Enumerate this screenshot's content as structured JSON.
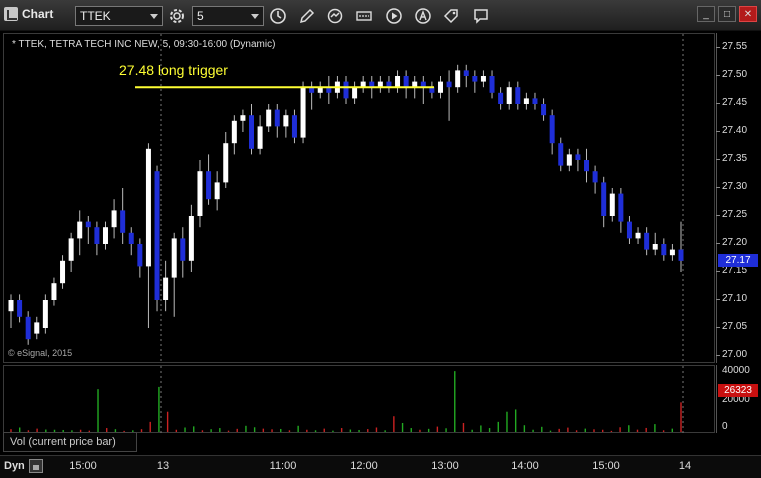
{
  "app": {
    "title": "Chart"
  },
  "toolbar": {
    "symbol": "TTEK",
    "interval": "5",
    "icons": [
      "gear-icon",
      "clock-icon",
      "pencil-icon",
      "refresh-icon",
      "quote-icon",
      "play-icon",
      "alert-icon",
      "tag-icon",
      "chat-icon"
    ]
  },
  "chart": {
    "info": "* TTEK, TETRA TECH INC NEW, 5, 09:30-16:00 (Dynamic)",
    "annotation": "27.48 long trigger",
    "copyright": "© eSignal, 2015",
    "last_price": "27.17",
    "price_ticks": [
      "27.55",
      "27.50",
      "27.45",
      "27.40",
      "27.35",
      "27.30",
      "27.25",
      "27.20",
      "27.15",
      "27.10",
      "27.05",
      "27.00"
    ],
    "volume_label": "Vol (current price bar)",
    "volume_ticks": [
      "40000",
      "20000",
      "0"
    ],
    "last_volume": "26323",
    "time_ticks": [
      "15:00",
      "13",
      "11:00",
      "12:00",
      "13:00",
      "14:00",
      "15:00",
      "14"
    ],
    "dyn_label": "Dyn",
    "colors": {
      "up": "#ffffff",
      "down": "#1f2ed8",
      "trigger": "#ffff33",
      "vol_up": "#22aa22",
      "vol_down": "#cc2222",
      "session_line": "#777777"
    }
  },
  "chart_data": {
    "type": "candlestick",
    "trigger_price": 27.48,
    "ylim": [
      27.0,
      27.56
    ],
    "candles": [
      [
        27.08,
        27.1,
        27.05,
        27.11,
        "u"
      ],
      [
        27.1,
        27.07,
        27.06,
        27.11,
        "d"
      ],
      [
        27.07,
        27.03,
        27.02,
        27.08,
        "d"
      ],
      [
        27.04,
        27.06,
        27.03,
        27.07,
        "u"
      ],
      [
        27.05,
        27.1,
        27.04,
        27.11,
        "u"
      ],
      [
        27.1,
        27.13,
        27.09,
        27.14,
        "u"
      ],
      [
        27.13,
        27.17,
        27.12,
        27.18,
        "u"
      ],
      [
        27.17,
        27.21,
        27.15,
        27.22,
        "u"
      ],
      [
        27.21,
        27.24,
        27.18,
        27.26,
        "u"
      ],
      [
        27.24,
        27.23,
        27.2,
        27.25,
        "d"
      ],
      [
        27.23,
        27.2,
        27.18,
        27.24,
        "d"
      ],
      [
        27.2,
        27.23,
        27.19,
        27.24,
        "u"
      ],
      [
        27.23,
        27.26,
        27.21,
        27.28,
        "u"
      ],
      [
        27.26,
        27.22,
        27.2,
        27.3,
        "d"
      ],
      [
        27.22,
        27.2,
        27.18,
        27.23,
        "d"
      ],
      [
        27.2,
        27.16,
        27.14,
        27.21,
        "d"
      ],
      [
        27.16,
        27.37,
        27.05,
        27.38,
        "u"
      ],
      [
        27.33,
        27.1,
        27.08,
        27.34,
        "d"
      ],
      [
        27.1,
        27.14,
        27.08,
        27.17,
        "u"
      ],
      [
        27.14,
        27.21,
        27.07,
        27.22,
        "u"
      ],
      [
        27.21,
        27.17,
        27.14,
        27.23,
        "d"
      ],
      [
        27.17,
        27.25,
        27.15,
        27.27,
        "u"
      ],
      [
        27.25,
        27.33,
        27.23,
        27.35,
        "u"
      ],
      [
        27.33,
        27.28,
        27.27,
        27.36,
        "d"
      ],
      [
        27.28,
        27.31,
        27.26,
        27.33,
        "u"
      ],
      [
        27.31,
        27.38,
        27.3,
        27.4,
        "u"
      ],
      [
        27.38,
        27.42,
        27.36,
        27.43,
        "u"
      ],
      [
        27.42,
        27.43,
        27.4,
        27.44,
        "u"
      ],
      [
        27.43,
        27.37,
        27.36,
        27.45,
        "d"
      ],
      [
        27.37,
        27.41,
        27.36,
        27.43,
        "u"
      ],
      [
        27.41,
        27.44,
        27.4,
        27.45,
        "u"
      ],
      [
        27.44,
        27.41,
        27.39,
        27.45,
        "d"
      ],
      [
        27.41,
        27.43,
        27.39,
        27.44,
        "u"
      ],
      [
        27.43,
        27.39,
        27.38,
        27.44,
        "d"
      ],
      [
        27.39,
        27.48,
        27.38,
        27.49,
        "u"
      ],
      [
        27.48,
        27.47,
        27.44,
        27.49,
        "d"
      ],
      [
        27.47,
        27.48,
        27.46,
        27.49,
        "u"
      ],
      [
        27.48,
        27.47,
        27.45,
        27.5,
        "d"
      ],
      [
        27.47,
        27.49,
        27.46,
        27.5,
        "u"
      ],
      [
        27.49,
        27.46,
        27.45,
        27.5,
        "d"
      ],
      [
        27.46,
        27.48,
        27.45,
        27.49,
        "u"
      ],
      [
        27.48,
        27.49,
        27.47,
        27.5,
        "u"
      ],
      [
        27.49,
        27.48,
        27.46,
        27.5,
        "d"
      ],
      [
        27.48,
        27.49,
        27.47,
        27.5,
        "u"
      ],
      [
        27.49,
        27.48,
        27.47,
        27.5,
        "d"
      ],
      [
        27.48,
        27.5,
        27.47,
        27.51,
        "u"
      ],
      [
        27.5,
        27.48,
        27.46,
        27.51,
        "d"
      ],
      [
        27.48,
        27.49,
        27.46,
        27.5,
        "u"
      ],
      [
        27.49,
        27.48,
        27.45,
        27.5,
        "d"
      ],
      [
        27.48,
        27.47,
        27.46,
        27.49,
        "d"
      ],
      [
        27.47,
        27.49,
        27.46,
        27.5,
        "u"
      ],
      [
        27.49,
        27.48,
        27.42,
        27.51,
        "d"
      ],
      [
        27.48,
        27.51,
        27.47,
        27.52,
        "u"
      ],
      [
        27.51,
        27.5,
        27.48,
        27.52,
        "d"
      ],
      [
        27.5,
        27.49,
        27.47,
        27.51,
        "d"
      ],
      [
        27.49,
        27.5,
        27.48,
        27.51,
        "u"
      ],
      [
        27.5,
        27.47,
        27.46,
        27.51,
        "d"
      ],
      [
        27.47,
        27.45,
        27.44,
        27.48,
        "d"
      ],
      [
        27.45,
        27.48,
        27.44,
        27.49,
        "u"
      ],
      [
        27.48,
        27.45,
        27.44,
        27.49,
        "d"
      ],
      [
        27.45,
        27.46,
        27.44,
        27.47,
        "u"
      ],
      [
        27.46,
        27.45,
        27.44,
        27.47,
        "d"
      ],
      [
        27.45,
        27.43,
        27.42,
        27.46,
        "d"
      ],
      [
        27.43,
        27.38,
        27.36,
        27.44,
        "d"
      ],
      [
        27.38,
        27.34,
        27.33,
        27.39,
        "d"
      ],
      [
        27.34,
        27.36,
        27.33,
        27.37,
        "u"
      ],
      [
        27.36,
        27.35,
        27.33,
        27.37,
        "d"
      ],
      [
        27.35,
        27.33,
        27.31,
        27.37,
        "d"
      ],
      [
        27.33,
        27.31,
        27.29,
        27.34,
        "d"
      ],
      [
        27.31,
        27.25,
        27.23,
        27.32,
        "d"
      ],
      [
        27.25,
        27.29,
        27.24,
        27.3,
        "u"
      ],
      [
        27.29,
        27.24,
        27.22,
        27.3,
        "d"
      ],
      [
        27.24,
        27.21,
        27.2,
        27.25,
        "d"
      ],
      [
        27.21,
        27.22,
        27.2,
        27.23,
        "u"
      ],
      [
        27.22,
        27.19,
        27.18,
        27.23,
        "d"
      ],
      [
        27.19,
        27.2,
        27.18,
        27.22,
        "u"
      ],
      [
        27.2,
        27.18,
        27.17,
        27.21,
        "d"
      ],
      [
        27.18,
        27.19,
        27.17,
        27.2,
        "u"
      ],
      [
        27.19,
        27.17,
        27.15,
        27.24,
        "d"
      ]
    ],
    "volumes": [
      [
        2500,
        "d"
      ],
      [
        4000,
        "u"
      ],
      [
        1500,
        "d"
      ],
      [
        3000,
        "d"
      ],
      [
        2200,
        "u"
      ],
      [
        2000,
        "u"
      ],
      [
        1800,
        "u"
      ],
      [
        1500,
        "u"
      ],
      [
        2000,
        "d"
      ],
      [
        1200,
        "d"
      ],
      [
        38000,
        "u"
      ],
      [
        3500,
        "d"
      ],
      [
        2500,
        "u"
      ],
      [
        1000,
        "d"
      ],
      [
        1500,
        "u"
      ],
      [
        2500,
        "d"
      ],
      [
        9000,
        "d"
      ],
      [
        40000,
        "u"
      ],
      [
        18000,
        "d"
      ],
      [
        2000,
        "d"
      ],
      [
        4000,
        "u"
      ],
      [
        5000,
        "u"
      ],
      [
        1500,
        "d"
      ],
      [
        2500,
        "u"
      ],
      [
        3500,
        "u"
      ],
      [
        1200,
        "d"
      ],
      [
        2800,
        "d"
      ],
      [
        5500,
        "u"
      ],
      [
        4200,
        "u"
      ],
      [
        3000,
        "d"
      ],
      [
        2400,
        "d"
      ],
      [
        2700,
        "u"
      ],
      [
        1500,
        "d"
      ],
      [
        5500,
        "u"
      ],
      [
        2000,
        "d"
      ],
      [
        1500,
        "u"
      ],
      [
        3000,
        "d"
      ],
      [
        1200,
        "u"
      ],
      [
        3500,
        "d"
      ],
      [
        2200,
        "u"
      ],
      [
        1800,
        "u"
      ],
      [
        2600,
        "d"
      ],
      [
        4000,
        "d"
      ],
      [
        1500,
        "u"
      ],
      [
        14000,
        "d"
      ],
      [
        8000,
        "u"
      ],
      [
        3500,
        "u"
      ],
      [
        2000,
        "d"
      ],
      [
        2800,
        "u"
      ],
      [
        4800,
        "d"
      ],
      [
        3300,
        "u"
      ],
      [
        54000,
        "u"
      ],
      [
        8000,
        "d"
      ],
      [
        2000,
        "u"
      ],
      [
        5800,
        "u"
      ],
      [
        3500,
        "u"
      ],
      [
        9000,
        "u"
      ],
      [
        18000,
        "u"
      ],
      [
        20000,
        "u"
      ],
      [
        6000,
        "u"
      ],
      [
        2000,
        "u"
      ],
      [
        4600,
        "u"
      ],
      [
        1200,
        "u"
      ],
      [
        2800,
        "d"
      ],
      [
        3900,
        "d"
      ],
      [
        1500,
        "d"
      ],
      [
        3000,
        "u"
      ],
      [
        2400,
        "d"
      ],
      [
        2000,
        "d"
      ],
      [
        1000,
        "d"
      ],
      [
        4200,
        "d"
      ],
      [
        6000,
        "u"
      ],
      [
        2100,
        "d"
      ],
      [
        3600,
        "d"
      ],
      [
        7000,
        "u"
      ],
      [
        1500,
        "d"
      ],
      [
        3000,
        "u"
      ],
      [
        26323,
        "d"
      ]
    ]
  }
}
